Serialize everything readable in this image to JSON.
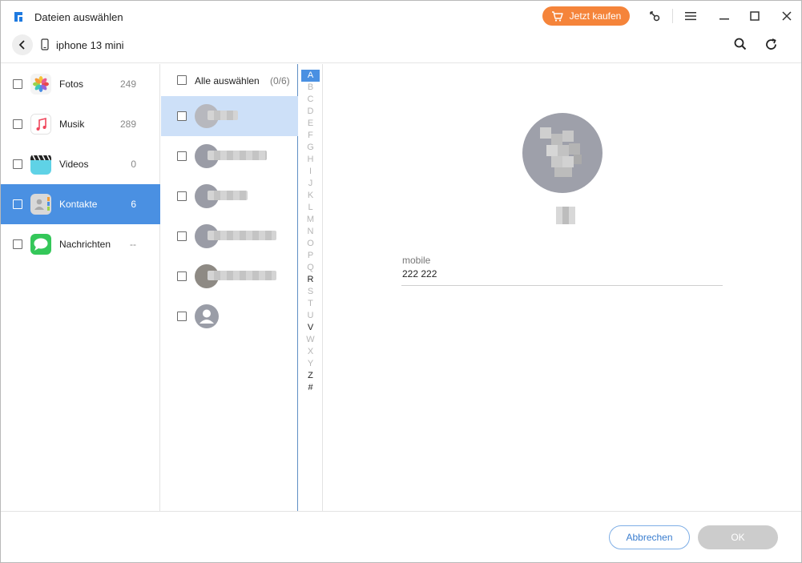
{
  "window": {
    "title": "Dateien auswählen"
  },
  "titlebar": {
    "buy_label": "Jetzt kaufen",
    "icons": [
      "key-icon",
      "menu-icon",
      "minimize-icon",
      "maximize-icon",
      "close-icon"
    ]
  },
  "device": {
    "name": "iphone 13 mini"
  },
  "toolbar": {
    "icons": [
      "search-icon",
      "refresh-icon"
    ]
  },
  "categories": [
    {
      "label": "Fotos",
      "count": "249",
      "icon": "photos-icon"
    },
    {
      "label": "Musik",
      "count": "289",
      "icon": "music-icon"
    },
    {
      "label": "Videos",
      "count": "0",
      "icon": "videos-icon"
    },
    {
      "label": "Kontakte",
      "count": "6",
      "icon": "contacts-icon",
      "active": true
    },
    {
      "label": "Nachrichten",
      "count": "--",
      "icon": "messages-icon"
    }
  ],
  "contacts": {
    "select_all_label": "Alle auswählen",
    "select_all_count": "(0/6)",
    "rows": 6
  },
  "alphabet": {
    "letters": [
      "A",
      "B",
      "C",
      "D",
      "E",
      "F",
      "G",
      "H",
      "I",
      "J",
      "K",
      "L",
      "M",
      "N",
      "O",
      "P",
      "Q",
      "R",
      "S",
      "T",
      "U",
      "V",
      "W",
      "X",
      "Y",
      "Z",
      "#"
    ],
    "active": "A",
    "available": [
      "A",
      "R",
      "V",
      "Z",
      "#"
    ]
  },
  "detail": {
    "field_label": "mobile",
    "field_value": "222 222"
  },
  "footer": {
    "cancel_label": "Abbrechen",
    "ok_label": "OK"
  },
  "colors": {
    "accent": "#4a90e2",
    "buy": "#f5843a",
    "selected_row": "#cde0f8",
    "ok_disabled": "#cccccc"
  }
}
